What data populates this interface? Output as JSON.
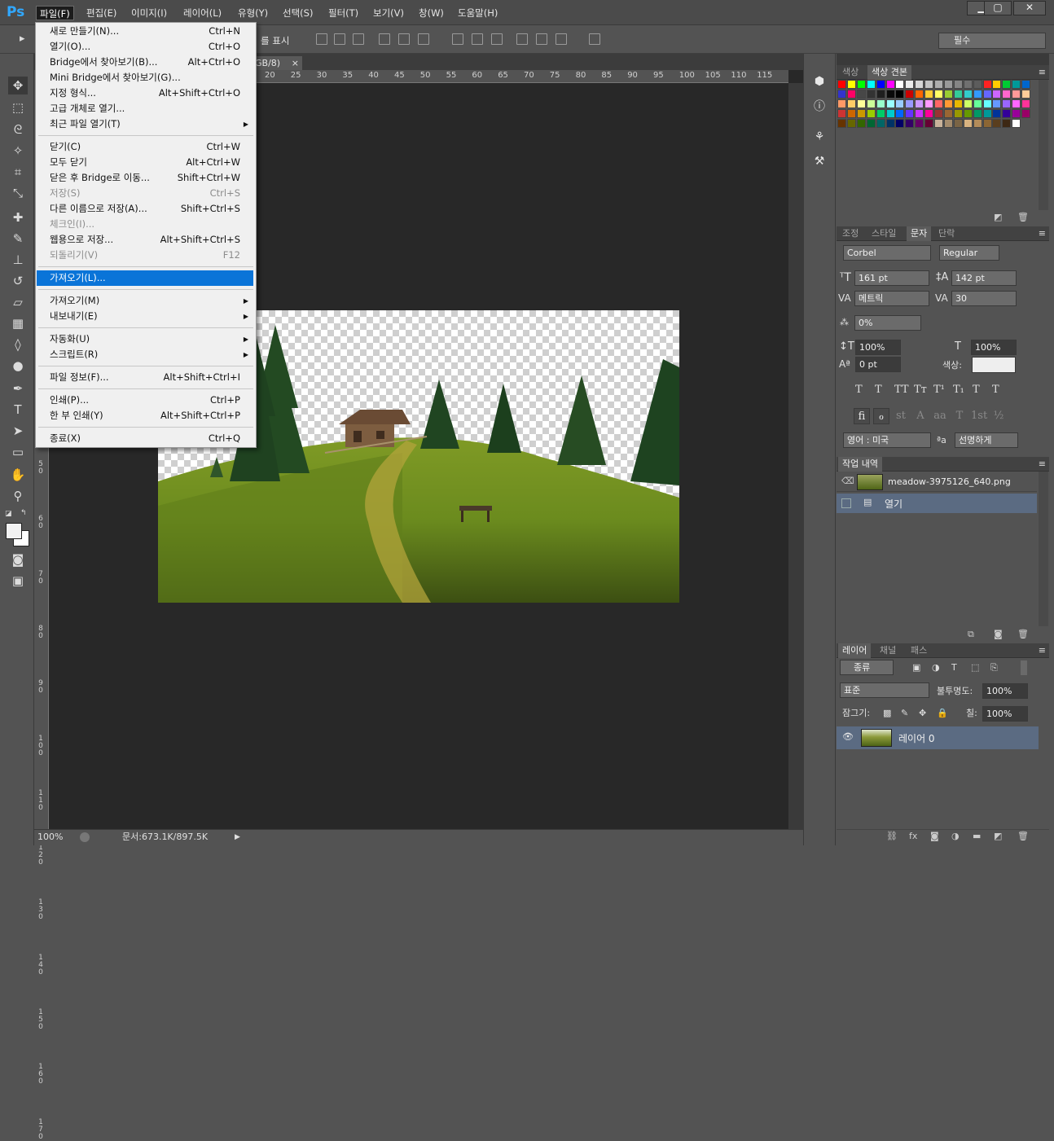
{
  "app": {
    "logo": "Ps"
  },
  "menubar": {
    "items": [
      "파일(F)",
      "편집(E)",
      "이미지(I)",
      "레이어(L)",
      "유형(Y)",
      "선택(S)",
      "필터(T)",
      "보기(V)",
      "창(W)",
      "도움말(H)"
    ],
    "window_buttons": [
      "▁",
      "▢",
      "✕"
    ]
  },
  "options": {
    "show_label": "를 표시",
    "workspace": "필수"
  },
  "document": {
    "tab_label": "GB/8)",
    "tab_close": "×",
    "ruler_ticks": [
      "20",
      "25",
      "30",
      "35",
      "40",
      "45",
      "50",
      "55",
      "60",
      "65",
      "70",
      "75",
      "80",
      "85",
      "90",
      "95",
      "100",
      "105",
      "110",
      "115"
    ],
    "vruler_ticks": [
      "5 0",
      "6 0",
      "7 0",
      "8 0",
      "9 0",
      "1 0 0",
      "1 1 0",
      "1 2 0",
      "1 3 0",
      "1 4 0",
      "1 5 0",
      "1 6 0",
      "1 7 0"
    ],
    "zoom": "100%",
    "doc_size": "문서:673.1K/897.5K"
  },
  "file_menu": {
    "groups": [
      [
        {
          "label": "새로 만들기(N)...",
          "shortcut": "Ctrl+N"
        },
        {
          "label": "열기(O)...",
          "shortcut": "Ctrl+O"
        },
        {
          "label": "Bridge에서 찾아보기(B)...",
          "shortcut": "Alt+Ctrl+O"
        },
        {
          "label": "Mini Bridge에서 찾아보기(G)...",
          "shortcut": ""
        },
        {
          "label": "지정 형식...",
          "shortcut": "Alt+Shift+Ctrl+O"
        },
        {
          "label": "고급 개체로 열기...",
          "shortcut": ""
        },
        {
          "label": "최근 파일 열기(T)",
          "shortcut": "",
          "submenu": true
        }
      ],
      [
        {
          "label": "닫기(C)",
          "shortcut": "Ctrl+W"
        },
        {
          "label": "모두 닫기",
          "shortcut": "Alt+Ctrl+W"
        },
        {
          "label": "닫은 후 Bridge로 이동...",
          "shortcut": "Shift+Ctrl+W"
        },
        {
          "label": "저장(S)",
          "shortcut": "Ctrl+S",
          "disabled": true
        },
        {
          "label": "다른 이름으로 저장(A)...",
          "shortcut": "Shift+Ctrl+S"
        },
        {
          "label": "체크인(I)...",
          "shortcut": "",
          "disabled": true
        },
        {
          "label": "웹용으로 저장...",
          "shortcut": "Alt+Shift+Ctrl+S"
        },
        {
          "label": "되돌리기(V)",
          "shortcut": "F12",
          "disabled": true
        }
      ],
      [
        {
          "label": "가져오기(L)...",
          "shortcut": "",
          "highlight": true
        }
      ],
      [
        {
          "label": "가져오기(M)",
          "shortcut": "",
          "submenu": true
        },
        {
          "label": "내보내기(E)",
          "shortcut": "",
          "submenu": true
        }
      ],
      [
        {
          "label": "자동화(U)",
          "shortcut": "",
          "submenu": true
        },
        {
          "label": "스크립트(R)",
          "shortcut": "",
          "submenu": true
        }
      ],
      [
        {
          "label": "파일 정보(F)...",
          "shortcut": "Alt+Shift+Ctrl+I"
        }
      ],
      [
        {
          "label": "인쇄(P)...",
          "shortcut": "Ctrl+P"
        },
        {
          "label": "한 부 인쇄(Y)",
          "shortcut": "Alt+Shift+Ctrl+P"
        }
      ],
      [
        {
          "label": "종료(X)",
          "shortcut": "Ctrl+Q"
        }
      ]
    ]
  },
  "swatches_panel": {
    "tabs": [
      "색상",
      "색상 견본"
    ],
    "colors": [
      "#ff0000",
      "#ffff00",
      "#00ff00",
      "#00ffff",
      "#0000ff",
      "#ff00ff",
      "#ffffff",
      "#ebebeb",
      "#d6d6d6",
      "#c2c2c2",
      "#adadad",
      "#999999",
      "#858585",
      "#707070",
      "#5c5c5c",
      "#ff2222",
      "#ffcc00",
      "#00cc33",
      "#009999",
      "#0066cc",
      "#3333cc",
      "#ff0066",
      "#474747",
      "#333333",
      "#1f1f1f",
      "#0a0a0a",
      "#000000",
      "#cc0000",
      "#ff6600",
      "#ffcc33",
      "#ffff66",
      "#99cc33",
      "#33cc99",
      "#33cccc",
      "#3399ff",
      "#6666ff",
      "#cc66ff",
      "#ff66cc",
      "#ff9999",
      "#ffcc99",
      "#ff9966",
      "#ffcc66",
      "#ffff99",
      "#ccff99",
      "#99ffcc",
      "#99ffff",
      "#99ccff",
      "#9999ff",
      "#cc99ff",
      "#ff99ff",
      "#ff6666",
      "#ff9933",
      "#e6b800",
      "#ccff66",
      "#66ff99",
      "#66ffff",
      "#6699ff",
      "#9966ff",
      "#ff66ff",
      "#ff3399",
      "#cc3333",
      "#cc6600",
      "#cc9900",
      "#99cc00",
      "#00cc66",
      "#00cccc",
      "#0066ff",
      "#6633ff",
      "#cc33ff",
      "#ff0099",
      "#993333",
      "#996633",
      "#999900",
      "#669900",
      "#009966",
      "#009999",
      "#003399",
      "#330099",
      "#990099",
      "#990066",
      "#663300",
      "#666600",
      "#336600",
      "#006633",
      "#006666",
      "#003366",
      "#000066",
      "#330066",
      "#660066",
      "#660033",
      "#c8b29a",
      "#a38b6c",
      "#7a6445",
      "#d9b380",
      "#b38c5a",
      "#8c6634",
      "#5a3e1e",
      "#3d2814",
      "#ffffff"
    ]
  },
  "char_panel": {
    "tabs": [
      "조정",
      "스타일",
      "문자",
      "단락"
    ],
    "font_family": "Corbel",
    "font_style": "Regular",
    "font_size": "161 pt",
    "leading": "142 pt",
    "kerning": "메트릭",
    "tracking": "30",
    "tsume": "0%",
    "vscale": "100%",
    "hscale": "100%",
    "baseline": "0 pt",
    "color_label": "색상:",
    "text_color": "#eeeeee",
    "style_glyphs": [
      "T",
      "T",
      "TT",
      "Tт",
      "T¹",
      "T₁",
      "T",
      "T"
    ],
    "ot_glyphs": [
      "ﬁ",
      "ℴ",
      "st",
      "A",
      "aa",
      "T",
      "1st",
      "½"
    ],
    "language": "영어 : 미국",
    "aa_icon": "ªa",
    "antialias": "선명하게"
  },
  "history_panel": {
    "tab": "작업 내역",
    "snapshot": "meadow-3975126_640.png",
    "step": "열기"
  },
  "layers_panel": {
    "tabs": [
      "레이어",
      "채널",
      "패스"
    ],
    "filter": "종류",
    "blend": "표준",
    "opacity_label": "불투명도:",
    "opacity": "100%",
    "lock_label": "잠그기:",
    "fill_label": "칠:",
    "fill": "100%",
    "layer_name": "레이어 0"
  },
  "colors": {
    "accent": "#0a74d8",
    "selected_row": "#5b6b82"
  }
}
